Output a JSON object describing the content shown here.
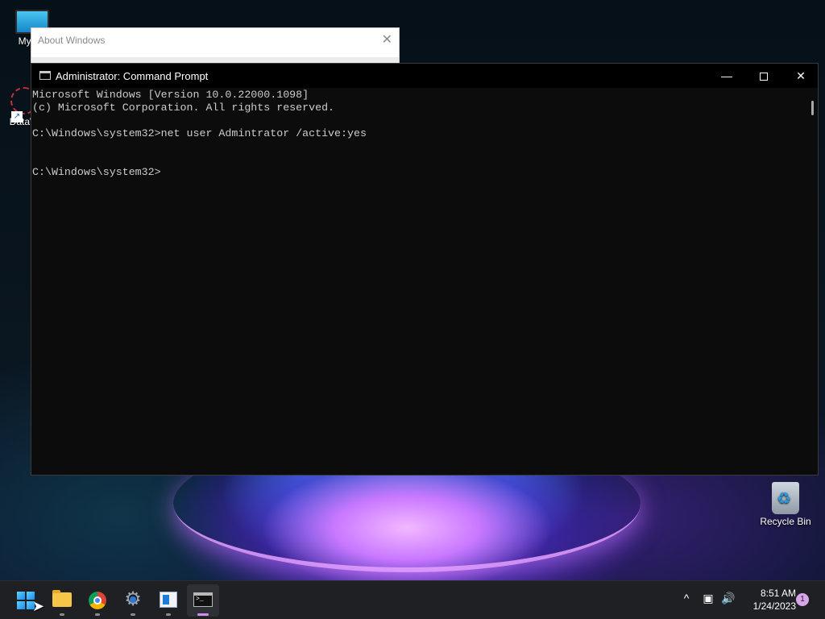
{
  "desktop": {
    "icons": [
      {
        "label": "My Co",
        "icon": "monitor-icon"
      },
      {
        "label": "DataW",
        "icon": "datawrangler-icon"
      },
      {
        "label": "Recycle Bin",
        "icon": "recycle-bin-icon"
      }
    ]
  },
  "about_window": {
    "title": "About Windows",
    "close_glyph": "✕"
  },
  "cmd_window": {
    "title": "Administrator: Command Prompt",
    "controls": {
      "minimize": "—",
      "close": "✕"
    },
    "lines": [
      "Microsoft Windows [Version 10.0.22000.1098]",
      "(c) Microsoft Corporation. All rights reserved.",
      "",
      "C:\\Windows\\system32>net user Admintrator /active:yes",
      "",
      "",
      "C:\\Windows\\system32>"
    ]
  },
  "taskbar": {
    "items": [
      {
        "name": "start",
        "icon": "windows-start-icon"
      },
      {
        "name": "file-explorer",
        "icon": "folder-icon"
      },
      {
        "name": "chrome",
        "icon": "chrome-icon"
      },
      {
        "name": "settings",
        "icon": "gear-icon"
      },
      {
        "name": "notepad",
        "icon": "notepad-icon"
      },
      {
        "name": "command-prompt",
        "icon": "terminal-icon",
        "active": true
      }
    ],
    "tray": {
      "chevron": "^",
      "time": "8:51 AM",
      "date": "1/24/2023",
      "notification_count": "1"
    }
  },
  "colors": {
    "cmd_background": "#0c0c0c",
    "cmd_text": "#cccccc",
    "taskbar": "#1f2024",
    "accent": "#d58cf0"
  }
}
